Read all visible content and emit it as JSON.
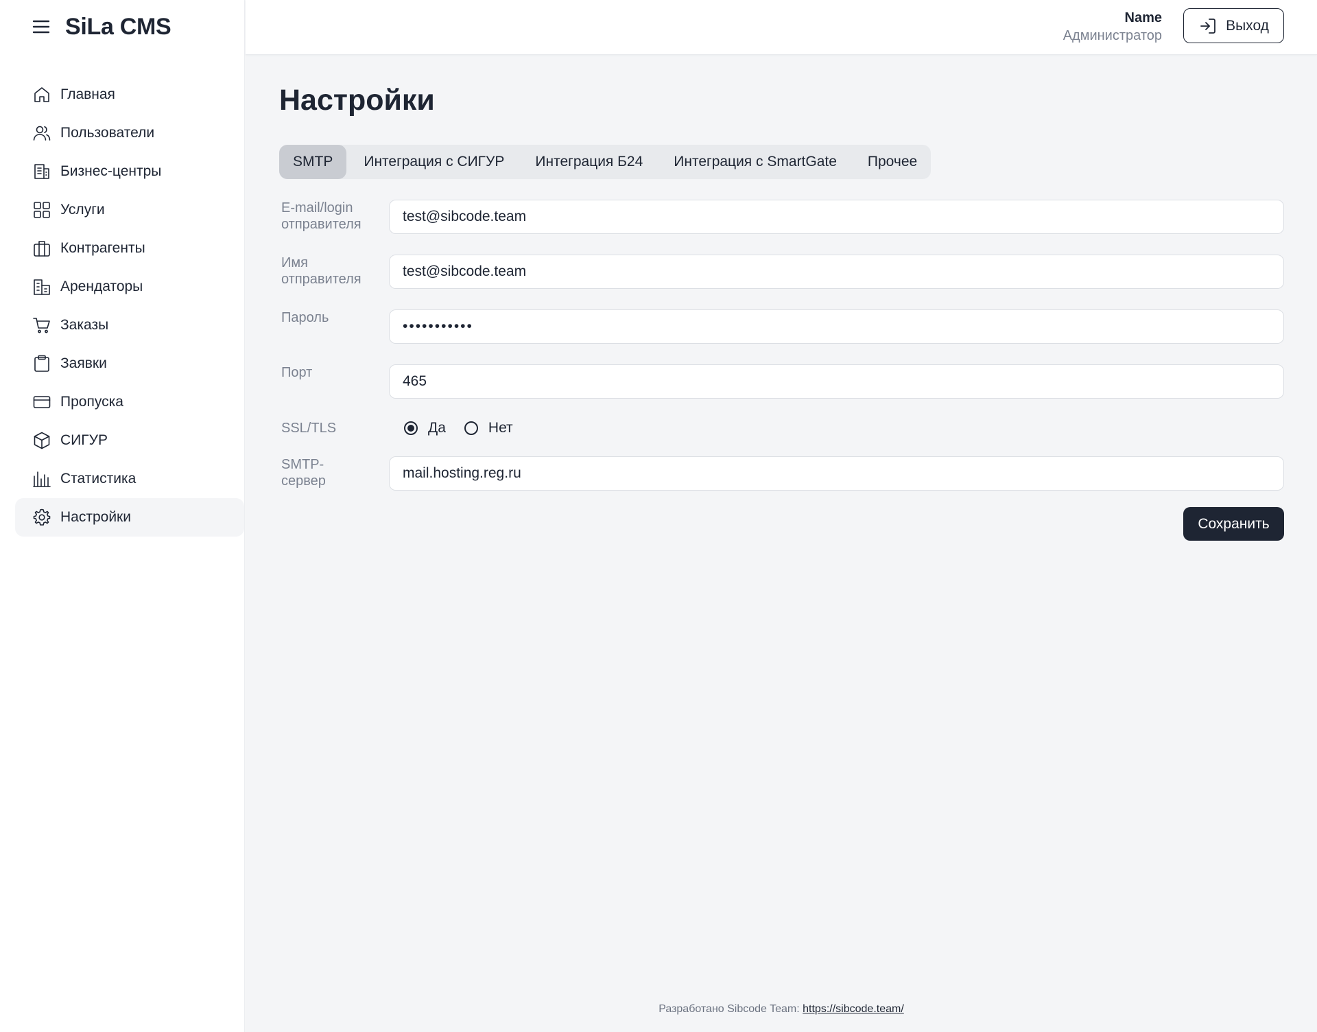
{
  "app": {
    "brand": "SiLa CMS"
  },
  "sidebar": {
    "items": [
      {
        "label": "Главная",
        "icon": "home-icon"
      },
      {
        "label": "Пользователи",
        "icon": "users-icon"
      },
      {
        "label": "Бизнес-центры",
        "icon": "building-icon"
      },
      {
        "label": "Услуги",
        "icon": "grid-icon"
      },
      {
        "label": "Контрагенты",
        "icon": "briefcase-icon"
      },
      {
        "label": "Арендаторы",
        "icon": "office-icon"
      },
      {
        "label": "Заказы",
        "icon": "cart-icon"
      },
      {
        "label": "Заявки",
        "icon": "clipboard-icon"
      },
      {
        "label": "Пропуска",
        "icon": "card-icon"
      },
      {
        "label": "СИГУР",
        "icon": "cube-icon"
      },
      {
        "label": "Статистика",
        "icon": "bars-icon"
      },
      {
        "label": "Настройки",
        "icon": "gear-icon",
        "active": true
      }
    ]
  },
  "header": {
    "user_name": "Name",
    "user_role": "Администратор",
    "logout_label": "Выход"
  },
  "main": {
    "title": "Настройки",
    "tabs": [
      {
        "label": "SMTP",
        "active": true
      },
      {
        "label": "Интеграция с СИГУР"
      },
      {
        "label": "Интеграция Б24"
      },
      {
        "label": "Интеграция с SmartGate"
      },
      {
        "label": "Прочее"
      }
    ],
    "form": {
      "email_label": "E-mail/login отправителя",
      "email_value": "test@sibcode.team",
      "sender_label": "Имя отправителя",
      "sender_value": "test@sibcode.team",
      "password_label": "Пароль",
      "password_value": "•••••••••••",
      "port_label": "Порт",
      "port_value": "465",
      "ssl_label": "SSL/TLS",
      "ssl_yes": "Да",
      "ssl_no": "Нет",
      "ssl_selected": "Да",
      "server_label": "SMTP-сервер",
      "server_value": "mail.hosting.reg.ru"
    },
    "save_label": "Сохранить"
  },
  "footer": {
    "text": "Разработано Sibcode Team:",
    "link": "https://sibcode.team/"
  },
  "colors": {
    "primary": "#1e2533",
    "muted": "#7b8290",
    "background": "#f4f5f7"
  }
}
